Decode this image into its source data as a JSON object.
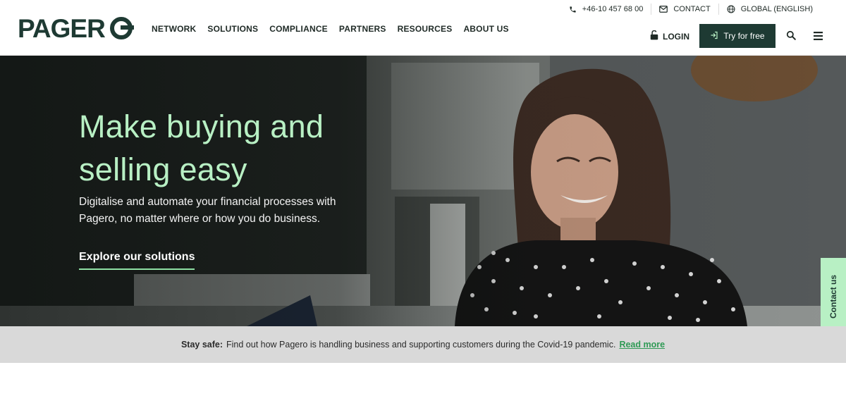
{
  "header": {
    "logo_text": "PAGERO",
    "nav": [
      "NETWORK",
      "SOLUTIONS",
      "COMPLIANCE",
      "PARTNERS",
      "RESOURCES",
      "ABOUT US"
    ],
    "utility": {
      "phone": "+46-10 457 68 00",
      "contact": "CONTACT",
      "language": "GLOBAL (ENGLISH)"
    },
    "login_label": "LOGIN",
    "try_label": "Try for free",
    "icons": [
      "phone-icon",
      "mail-icon",
      "globe-icon",
      "lock-icon",
      "sign-in-icon",
      "search-icon",
      "menu-icon"
    ]
  },
  "hero": {
    "title_line1": "Make buying and",
    "title_line2": "selling easy",
    "text_line1": "Digitalise and automate your financial processes with",
    "text_line2": "Pagero, no matter where or how you do business.",
    "cta": "Explore our solutions"
  },
  "contact_tab": "Contact us",
  "notice": {
    "label": "Stay safe:",
    "text": "Find out how Pagero is handling business and supporting customers during the Covid-19 pandemic.",
    "link": "Read more"
  },
  "colors": {
    "brand_dark": "#1e3a33",
    "accent_green": "#b8f0c4",
    "link_green": "#2f9a55",
    "notice_bg": "#d9d9d9"
  }
}
